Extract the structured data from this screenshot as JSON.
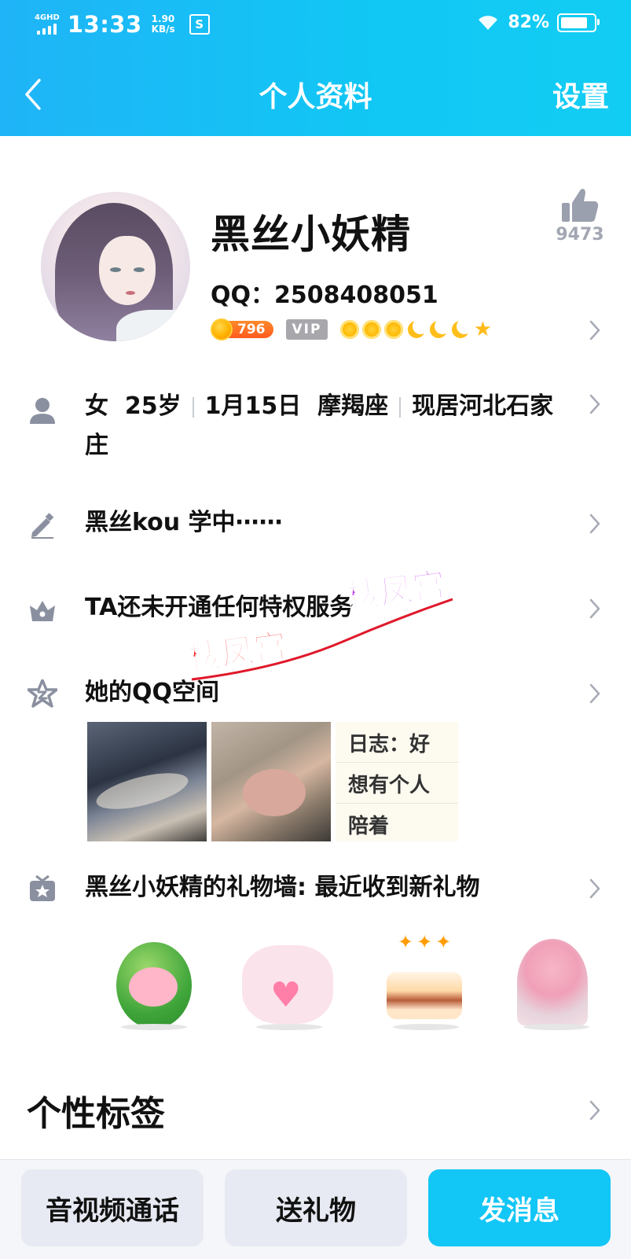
{
  "status_bar": {
    "network": "4GHD",
    "time": "13:33",
    "speed_value": "1.90",
    "speed_unit": "KB/s",
    "app_icon": "S",
    "battery_percent": "82%",
    "battery_level": 0.82
  },
  "nav": {
    "title": "个人资料",
    "right_action": "设置"
  },
  "profile": {
    "nickname": "黑丝小妖精",
    "qq_label": "QQ：2508408051",
    "like_count": "9473",
    "coin_value": "796",
    "vip_label": "VIP",
    "level_icons": [
      "sun",
      "sun",
      "sun",
      "moon",
      "moon",
      "moon",
      "star"
    ]
  },
  "info_rows": {
    "basic": {
      "gender": "女",
      "age": "25岁",
      "birthday": "1月15日",
      "zodiac": "摩羯座",
      "location_line1": "现居河北石家",
      "location_line2": "庄"
    },
    "signature": "黑丝kou  学中⋯⋯",
    "privilege": "TA还未开通任何特权服务",
    "qzone": "她的QQ空间",
    "qzone_journal": [
      "日志：好",
      "想有个人",
      "陪着"
    ],
    "gift_wall": "黑丝小妖精的礼物墙: 最近收到新礼物"
  },
  "gifts": [
    "watermelon-pig",
    "bears-heart",
    "birthday-cake",
    "flower-bouquet"
  ],
  "tags_section": {
    "title": "个性标签"
  },
  "bottom_bar": {
    "call_button": "音视频通话",
    "gift_button": "送礼物",
    "message_button": "发消息"
  },
  "watermark": {
    "text": "楼凤宫"
  },
  "colors": {
    "header": "#12c6f6",
    "primary_button": "#12c6f6",
    "icon_gray": "#8b90a0"
  }
}
